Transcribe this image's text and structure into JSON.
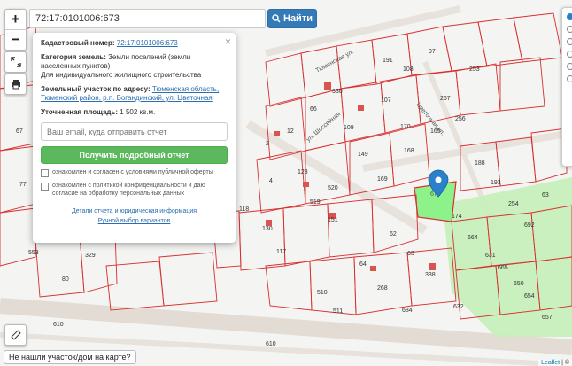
{
  "search": {
    "value": "72:17:0101006:673",
    "button_label": "Найти"
  },
  "popup": {
    "cadastral_label": "Кадастровый номер:",
    "cadastral_value": "72:17:0101006:673",
    "category_label": "Категория земель:",
    "category_value": "Земли поселений (земли населенных пунктов)",
    "permitted_use": "Для индивидуального жилищного строительства",
    "address_label": "Земельный участок по адресу:",
    "address_value": "Тюменская область, Тюменский район, р.п. Богандинский, ул. Цветочная",
    "area_label": "Уточненная площадь:",
    "area_value": "1 502 кв.м.",
    "email_placeholder": "Ваш email, куда отправить отчет",
    "get_report_label": "Получить подробный отчет",
    "consent_offer": "ознакомлен и согласен с условиями публичной оферты",
    "consent_privacy": "ознакомлен с политикой конфиденциальности и даю согласие на обработку персональных данных",
    "report_details_link": "Детали отчета и юридическая информация",
    "manual_select_link": "Ручной выбор вариантов"
  },
  "not_found_label": "Не нашли участок/дом на карте?",
  "attribution": {
    "leaflet": "Leaflet",
    "sep": " | ©"
  },
  "colors": {
    "parcel_border": "#d63030",
    "selected_fill": "#8ef28a",
    "highlight_fill": "#c7f0b9",
    "road": "#e7e2dc",
    "building": "#d9534f",
    "marker": "#2a81cb",
    "search_button": "#337ab7",
    "report_button": "#5cb85c"
  },
  "map": {
    "selected_parcel": "673",
    "parcel_labels": [
      "118",
      "191",
      "97",
      "253",
      "66",
      "330",
      "107",
      "12",
      "108",
      "267",
      "256",
      "109",
      "2",
      "170",
      "149",
      "165",
      "168",
      "128",
      "4",
      "130",
      "169",
      "188",
      "193",
      "520",
      "519",
      "151",
      "118",
      "117",
      "174",
      "254",
      "62",
      "664",
      "692",
      "64",
      "63",
      "631",
      "338",
      "665",
      "650",
      "268",
      "510",
      "632",
      "654",
      "657",
      "511",
      "684",
      "610",
      "610",
      "553",
      "329",
      "67",
      "77",
      "80",
      "63"
    ],
    "street_labels": [
      "Тюменская ул.",
      "Цветочная ул.",
      "ул. Шоссейная"
    ]
  }
}
